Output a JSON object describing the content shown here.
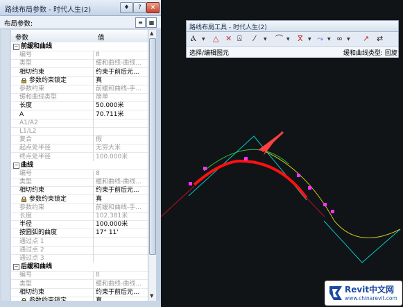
{
  "palette": {
    "title": "路线布局参数 - 时代人生(2)",
    "caption_buttons": [
      "♦",
      "?",
      "×"
    ],
    "subheader": "布局参数:",
    "col_param": "参数",
    "col_value": "值",
    "sections": [
      {
        "name": "前缓和曲线",
        "rows": [
          {
            "name": "编号",
            "value": "8",
            "dim": true
          },
          {
            "name": "类型",
            "value": "缓和曲线-曲线...",
            "dim": true
          },
          {
            "name": "相切约束",
            "value": "约束于前后元...",
            "dim": false
          },
          {
            "name": "参数约束锁定",
            "value": "真",
            "dim": false,
            "lock": true
          },
          {
            "name": "参数约束",
            "value": "前缓和曲线-手...",
            "dim": true
          },
          {
            "name": "缓和曲线类型",
            "value": "简单",
            "dim": true
          },
          {
            "name": "长度",
            "value": "50.000米",
            "dim": false
          },
          {
            "name": "A",
            "value": "70.711米",
            "dim": false
          },
          {
            "name": "A1/A2",
            "value": "",
            "dim": true
          },
          {
            "name": "L1/L2",
            "value": "",
            "dim": true
          },
          {
            "name": "复合",
            "value": "假",
            "dim": true
          },
          {
            "name": "起点处半径",
            "value": "无穷大米",
            "dim": true
          },
          {
            "name": "终点处半径",
            "value": "100.000米",
            "dim": true
          }
        ]
      },
      {
        "name": "曲线",
        "rows": [
          {
            "name": "编号",
            "value": "8",
            "dim": true
          },
          {
            "name": "类型",
            "value": "缓和曲线-曲线...",
            "dim": true
          },
          {
            "name": "相切约束",
            "value": "约束于前后元...",
            "dim": false
          },
          {
            "name": "参数约束锁定",
            "value": "真",
            "dim": false,
            "lock": true
          },
          {
            "name": "参数约束",
            "value": "前缓和曲线-手...",
            "dim": true
          },
          {
            "name": "长度",
            "value": "102.381米",
            "dim": true
          },
          {
            "name": "半径",
            "value": "100.000米",
            "dim": false
          },
          {
            "name": "按圆弧的曲度",
            "value": "17° 11'",
            "dim": false
          },
          {
            "name": "通过点 1",
            "value": "",
            "dim": true
          },
          {
            "name": "通过点 2",
            "value": "",
            "dim": true
          },
          {
            "name": "通过点 3",
            "value": "",
            "dim": true
          }
        ]
      },
      {
        "name": "后缓和曲线",
        "rows": [
          {
            "name": "编号",
            "value": "8",
            "dim": true
          },
          {
            "name": "类型",
            "value": "缓和曲线-曲线...",
            "dim": true
          },
          {
            "name": "相切约束",
            "value": "约束于前后元...",
            "dim": false
          },
          {
            "name": "参数约束锁定",
            "value": "真",
            "dim": false,
            "lock": true
          }
        ]
      }
    ]
  },
  "toolbar": {
    "title": "路线布局工具 - 时代人生(2)",
    "status_left": "选择/编辑图元",
    "status_right": "缓和曲线类型: 回旋",
    "icons": [
      "line-tool-icon",
      "tangent-tool-icon",
      "delete-pi-icon",
      "pi-tool-icon",
      "tangent-line-icon",
      "curve-tool-icon",
      "fixed-entity-icon",
      "free-entity-icon",
      "spiral-tool-icon",
      "edit-tool-icon",
      "reverse-icon"
    ]
  },
  "logo": {
    "big": "Revit中文网",
    "small": "www.chinarevit.com"
  },
  "colors": {
    "canvas": "#111417",
    "alignment_red": "#ff1010",
    "tangent_cyan": "#00c8c8",
    "offset_yellow": "#c8c020",
    "grip_magenta": "#ff30ff",
    "pointer": "#ff4040"
  }
}
